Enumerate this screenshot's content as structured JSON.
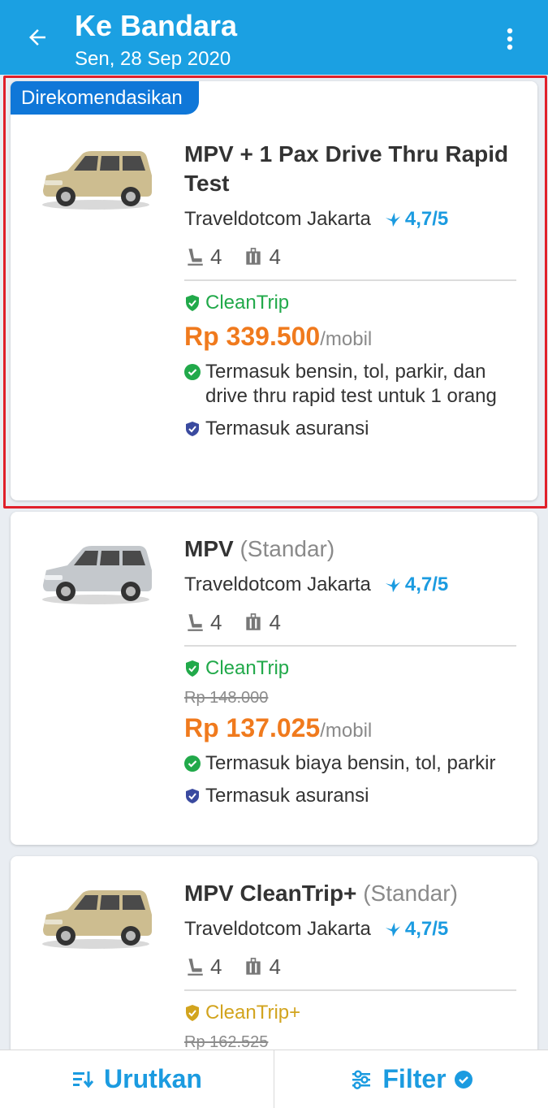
{
  "appbar": {
    "title": "Ke Bandara",
    "subtitle": "Sen, 28 Sep 2020",
    "back_icon": "arrow-back-icon",
    "more_icon": "more-vertical-icon",
    "color": "#1ba0e2"
  },
  "cards": [
    {
      "badge": "Direkomendasikan",
      "name": "MPV + 1 Pax Drive Thru Rapid Test",
      "type": "",
      "provider": "Traveldotcom Jakarta",
      "rating": "4,7/5",
      "seats": "4",
      "luggage": "4",
      "clean_label": "CleanTrip",
      "original_price": "",
      "price": "Rp 339.500",
      "unit": "/mobil",
      "includes": "Termasuk bensin, tol, parkir, dan drive thru rapid test untuk  1 orang",
      "insurance": "Termasuk asuransi",
      "car_color": "gold"
    },
    {
      "name": "MPV",
      "type": "(Standar)",
      "provider": "Traveldotcom Jakarta",
      "rating": "4,7/5",
      "seats": "4",
      "luggage": "4",
      "clean_label": "CleanTrip",
      "original_price": "Rp 148.000",
      "price": "Rp 137.025",
      "unit": "/mobil",
      "includes": "Termasuk biaya bensin, tol, parkir",
      "insurance": "Termasuk asuransi",
      "car_color": "silver"
    },
    {
      "name": "MPV CleanTrip+",
      "type": "(Standar)",
      "provider": "Traveldotcom Jakarta",
      "rating": "4,7/5",
      "seats": "4",
      "luggage": "4",
      "clean_label": "CleanTrip+",
      "original_price": "Rp 162.525",
      "car_color": "gold"
    }
  ],
  "bottombar": {
    "sort_label": "Urutkan",
    "filter_label": "Filter"
  },
  "colors": {
    "accent": "#1b9be0",
    "price": "#f07a1d",
    "clean_green": "#21a94a",
    "clean_gold": "#d2a41e",
    "badge": "#0f77d8",
    "highlight": "#e0202a"
  }
}
